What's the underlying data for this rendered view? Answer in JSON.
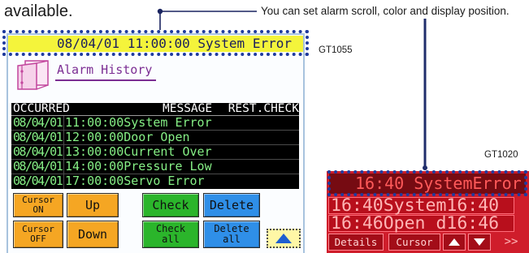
{
  "intro_text": "available.",
  "callout_text": "You can set alarm scroll, color and display position.",
  "gt1055": {
    "model_label": "GT1055",
    "alarm_bar_text": "08/04/01 11:00:00 System Error",
    "title": "Alarm History",
    "title_icon": "binder-icon",
    "table": {
      "headers": {
        "occurred": "OCCURRED",
        "message": "MESSAGE",
        "rest_check": "REST.CHECK"
      },
      "rows": [
        {
          "date": "08/04/01",
          "time": "11:00:00",
          "message": "System Error"
        },
        {
          "date": "08/04/01",
          "time": "12:00:00",
          "message": "Door Open"
        },
        {
          "date": "08/04/01",
          "time": "13:00:00",
          "message": "Current Over"
        },
        {
          "date": "08/04/01",
          "time": "14:00:00",
          "message": "Pressure Low"
        },
        {
          "date": "08/04/01",
          "time": "17:00:00",
          "message": "Servo Error"
        }
      ]
    },
    "buttons": {
      "cursor_on": {
        "line1": "Cursor",
        "line2": "ON"
      },
      "up": "Up",
      "check": "Check",
      "delete": "Delete",
      "cursor_off": {
        "line1": "Cursor",
        "line2": "OFF"
      },
      "down": "Down",
      "check_all": {
        "line1": "Check",
        "line2": "all"
      },
      "delete_all": {
        "line1": "Delete",
        "line2": "all"
      },
      "scroll_up_icon": "up-triangle-icon"
    }
  },
  "gt1020": {
    "model_label": "GT1020",
    "alarm_bar_text": "16:40 SystemError",
    "rows": [
      "16:40System16:40",
      "16:46Open d16:46"
    ],
    "buttons": {
      "details": "Details",
      "cursor": "Cursor",
      "up_icon": "up-triangle-icon",
      "down_icon": "down-triangle-icon",
      "next": ">>"
    }
  },
  "colors": {
    "alarm_bar": "#f4f43b",
    "alarm_bar_text": "#1b1f5c",
    "title": "#7b2d93",
    "table_text": "#86f086",
    "button_orange": "#f5a623",
    "button_green": "#2bb52b",
    "button_blue": "#2f8fe8",
    "gt1020_background": "#cf1d2b",
    "gt1020_alarm_bar": "#760b12",
    "gt1020_alarm_text": "#ff5a5a",
    "highlight_dots": "#1f3b9e"
  }
}
